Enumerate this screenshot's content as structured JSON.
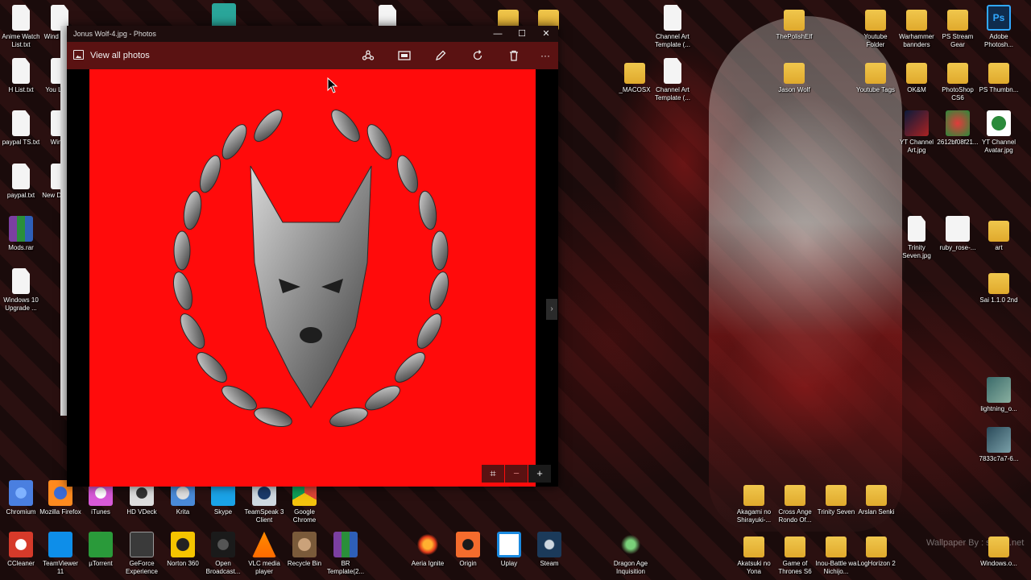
{
  "window": {
    "title": "Jonus Wolf-4.jpg - Photos",
    "controls": {
      "minimize": "—",
      "maximize": "☐",
      "close": "✕"
    },
    "toolbar": {
      "view_all_label": "View all photos",
      "buttons": [
        {
          "name": "share-button",
          "icon": "share-icon"
        },
        {
          "name": "slideshow-button",
          "icon": "slideshow-icon"
        },
        {
          "name": "edit-button",
          "icon": "pencil-icon"
        },
        {
          "name": "rotate-button",
          "icon": "rotate-icon"
        },
        {
          "name": "delete-button",
          "icon": "trash-icon"
        },
        {
          "name": "more-button",
          "icon": "more-icon",
          "label": "···"
        }
      ]
    },
    "photo": {
      "background": "#ff0b0b",
      "subject": "silver wolf head inside laurel wreath"
    },
    "nav_next_label": "›",
    "zoom": {
      "fit_label": "⌗",
      "minus": "−",
      "plus": "+"
    }
  },
  "accent_colors": {
    "toolbar": "#5a1212",
    "photo_bg": "#ff0b0b",
    "titlebar": "#1e0d0d"
  },
  "desktop": {
    "left_column": [
      {
        "label": "Anime Watch List.txt",
        "icon": "text-file-icon"
      },
      {
        "label": "Wind profe",
        "icon": "text-file-icon"
      },
      {
        "label": "H List.txt",
        "icon": "text-file-icon"
      },
      {
        "label": "You Login",
        "icon": "text-file-icon"
      },
      {
        "label": "paypal TS.txt",
        "icon": "text-file-icon"
      },
      {
        "label": "Windo",
        "icon": "text-file-icon"
      },
      {
        "label": "paypal.txt",
        "icon": "text-file-icon"
      },
      {
        "label": "New Docum",
        "icon": "text-file-icon"
      },
      {
        "label": "Mods.rar",
        "icon": "winrar-icon"
      },
      {
        "label": "Windows 10 Upgrade ...",
        "icon": "text-file-icon"
      }
    ],
    "right_area": [
      {
        "label": "Channel Art Template (...",
        "icon": "file-icon"
      },
      {
        "label": "ThePolishElf",
        "icon": "folder-icon"
      },
      {
        "label": "Youtube Folder",
        "icon": "folder-icon"
      },
      {
        "label": "Warhammer bannders",
        "icon": "folder-icon"
      },
      {
        "label": "PS Stream Gear",
        "icon": "folder-icon"
      },
      {
        "label": "Adobe Photosh...",
        "icon": "photoshop-icon",
        "glyph": "Ps"
      },
      {
        "label": "_MACOSX",
        "icon": "folder-icon"
      },
      {
        "label": "Channel Art Template (...",
        "icon": "file-icon"
      },
      {
        "label": "Jason Wolf",
        "icon": "folder-icon"
      },
      {
        "label": "Youtube Tags",
        "icon": "folder-icon"
      },
      {
        "label": "OK&M",
        "icon": "folder-icon"
      },
      {
        "label": "PhotoShop CS6",
        "icon": "folder-icon"
      },
      {
        "label": "PS Thumbn...",
        "icon": "folder-icon"
      },
      {
        "label": "YT Channel Art.jpg",
        "icon": "image-icon"
      },
      {
        "label": "2612bf08f21...",
        "icon": "image-icon"
      },
      {
        "label": "YT Channel Avatar.jpg",
        "icon": "image-icon"
      },
      {
        "label": "Trinity Seven.jpg",
        "icon": "file-icon"
      },
      {
        "label": "ruby_rose-...",
        "icon": "file-icon"
      },
      {
        "label": "art",
        "icon": "folder-icon"
      },
      {
        "label": "Sai 1.1.0 2nd",
        "icon": "folder-icon"
      },
      {
        "label": "lightning_o...",
        "icon": "image-icon"
      },
      {
        "label": "7833c7a7-6...",
        "icon": "image-icon"
      }
    ],
    "row_1": [
      {
        "label": "Chromium",
        "icon": "chromium-icon"
      },
      {
        "label": "Mozilla Firefox",
        "icon": "firefox-icon"
      },
      {
        "label": "iTunes",
        "icon": "itunes-icon"
      },
      {
        "label": "HD VDeck",
        "icon": "hdvdeck-icon"
      },
      {
        "label": "Krita",
        "icon": "krita-icon"
      },
      {
        "label": "Skype",
        "icon": "skype-icon"
      },
      {
        "label": "TeamSpeak 3 Client",
        "icon": "teamspeak-icon"
      },
      {
        "label": "Google Chrome",
        "icon": "chrome-icon"
      }
    ],
    "row_2": [
      {
        "label": "CCleaner",
        "icon": "ccleaner-icon"
      },
      {
        "label": "TeamViewer 11",
        "icon": "teamviewer-icon"
      },
      {
        "label": "µTorrent",
        "icon": "utorrent-icon"
      },
      {
        "label": "GeForce Experience",
        "icon": "geforce-icon"
      },
      {
        "label": "Norton 360",
        "icon": "norton-icon"
      },
      {
        "label": "Open Broadcast...",
        "icon": "obs-icon"
      },
      {
        "label": "VLC media player",
        "icon": "vlc-icon"
      },
      {
        "label": "Recycle Bin",
        "icon": "recycle-bin-icon"
      },
      {
        "label": "BR Template(2...",
        "icon": "winrar-icon"
      },
      {
        "label": "Aeria Ignite",
        "icon": "aeria-icon"
      },
      {
        "label": "Origin",
        "icon": "origin-icon"
      },
      {
        "label": "Uplay",
        "icon": "uplay-icon"
      },
      {
        "label": "Steam",
        "icon": "steam-icon"
      },
      {
        "label": "Dragon Age Inquisition",
        "icon": "dragon-age-icon"
      }
    ],
    "bottom_right": [
      {
        "label": "Akagami no Shirayuki-...",
        "icon": "folder-icon"
      },
      {
        "label": "Cross Ange Rondo Of...",
        "icon": "folder-icon"
      },
      {
        "label": "Trinity Seven",
        "icon": "folder-icon"
      },
      {
        "label": "Arslan Senki",
        "icon": "folder-icon"
      },
      {
        "label": "Akatsuki no Yona",
        "icon": "folder-icon"
      },
      {
        "label": "Game of Thrones S6",
        "icon": "folder-icon"
      },
      {
        "label": "Inou-Battle wa Nichijo...",
        "icon": "folder-icon"
      },
      {
        "label": "LogHorizon 2",
        "icon": "folder-icon"
      },
      {
        "label": "Windows.o...",
        "icon": "folder-icon"
      }
    ],
    "wallpaper_credit": "Wallpaper By : suc   le.net"
  }
}
